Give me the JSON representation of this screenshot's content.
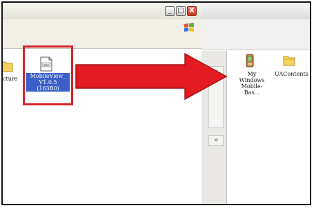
{
  "left_window": {
    "partial_label": "cture",
    "highlighted_file": {
      "icon_text": "exe",
      "label_lines": [
        "MobileView_",
        "V1.0.5",
        "(163B0)"
      ]
    },
    "title_buttons": [
      "_",
      "□",
      "X"
    ]
  },
  "right_window": {
    "scroll_buttons": {
      "up": "«",
      "down": "»"
    },
    "items": [
      {
        "label_lines": [
          "My Windows",
          "Mobile-Bas..."
        ]
      },
      {
        "label_lines": [
          "UAContents"
        ]
      }
    ]
  },
  "colors": {
    "arrow": "#e51b23",
    "highlight": "#d9222a",
    "selection": "#3a5fc8"
  }
}
